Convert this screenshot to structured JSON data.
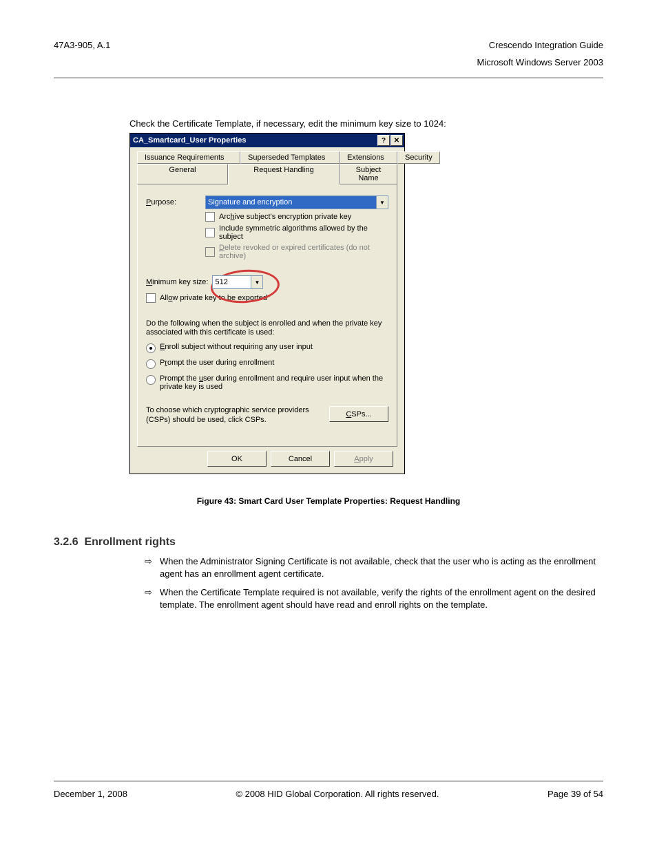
{
  "header": {
    "left": "47A3-905, A.1",
    "right1": "Crescendo Integration Guide",
    "right2": "Microsoft Windows Server 2003"
  },
  "intro": "Check the Certificate Template, if necessary, edit the minimum key size to 1024:",
  "dialog": {
    "title": "CA_Smartcard_User Properties",
    "help_glyph": "?",
    "close_glyph": "✕",
    "tabs_row1": [
      "Issuance Requirements",
      "Superseded Templates",
      "Extensions",
      "Security"
    ],
    "tabs_row2": [
      "General",
      "Request Handling",
      "Subject Name"
    ],
    "active_tab": "Request Handling",
    "purpose_label": "Purpose:",
    "purpose_value": "Signature and encryption",
    "chk_archive": "Archive subject's encryption private key",
    "chk_symmetric": "Include symmetric algorithms allowed by the subject",
    "chk_delete": "Delete revoked or expired certificates (do not archive)",
    "minkey_label": "Minimum key size:",
    "minkey_value": "512",
    "chk_export": "Allow private key to be exported",
    "instr": "Do the following when the subject is enrolled and when the private key associated with this certificate is used:",
    "radio1": "Enroll subject without requiring any user input",
    "radio2": "Prompt the user during enrollment",
    "radio3": "Prompt the user during enrollment and require user input when the private key is used",
    "csp_text": "To choose which cryptographic service providers (CSPs) should be used, click CSPs.",
    "csp_btn": "CSPs...",
    "ok": "OK",
    "cancel": "Cancel",
    "apply": "Apply"
  },
  "figure_caption": "Figure 43: Smart Card User Template Properties: Request Handling",
  "section": {
    "num": "3.2.6",
    "title": "Enrollment rights",
    "bullets": [
      "When the Administrator Signing Certificate is not available, check that the user who is acting as the enrollment agent has an enrollment agent certificate.",
      "When the Certificate Template required is not available, verify the rights of the enrollment agent on the desired template. The enrollment agent should have read and enroll rights on the template."
    ]
  },
  "footer": {
    "left": "December 1, 2008",
    "center": "© 2008 HID Global Corporation.  All rights reserved.",
    "right": "Page 39 of 54"
  }
}
